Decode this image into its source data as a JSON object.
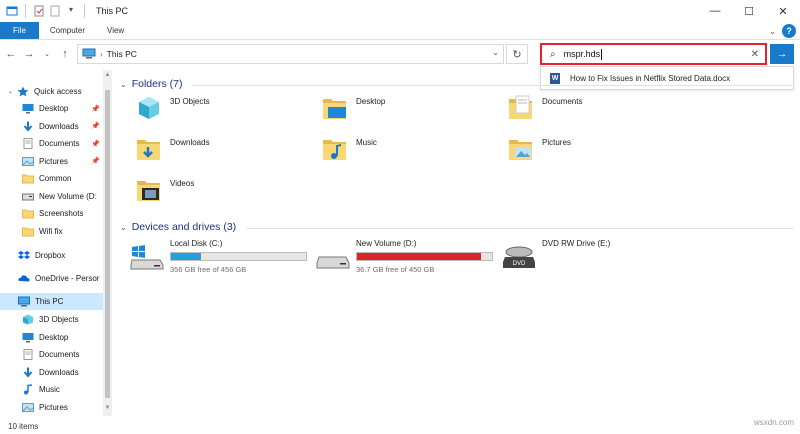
{
  "window": {
    "title": "This PC",
    "controls": [
      "minimize",
      "maximize",
      "close"
    ]
  },
  "ribbon": {
    "tabs": [
      "File",
      "Computer",
      "View"
    ]
  },
  "address": {
    "location": "This PC"
  },
  "search": {
    "value": "mspr.hds",
    "suggestion": "How to Fix Issues in Netflix Stored Data.docx"
  },
  "sidebar": {
    "quick_access": "Quick access",
    "quick_items": [
      {
        "label": "Desktop",
        "icon": "desktop-icon",
        "pinned": true
      },
      {
        "label": "Downloads",
        "icon": "downloads-icon",
        "pinned": true
      },
      {
        "label": "Documents",
        "icon": "documents-icon",
        "pinned": true
      },
      {
        "label": "Pictures",
        "icon": "pictures-icon",
        "pinned": true
      },
      {
        "label": "Common",
        "icon": "folder-icon",
        "pinned": false
      },
      {
        "label": "New Volume (D:",
        "icon": "drive-icon",
        "pinned": false
      },
      {
        "label": "Screenshots",
        "icon": "folder-icon",
        "pinned": false
      },
      {
        "label": "Wifi fix",
        "icon": "folder-icon",
        "pinned": false
      }
    ],
    "dropbox": "Dropbox",
    "onedrive": "OneDrive - Persor",
    "this_pc": "This PC",
    "pc_items": [
      {
        "label": "3D Objects",
        "icon": "3d-objects-icon"
      },
      {
        "label": "Desktop",
        "icon": "desktop-icon"
      },
      {
        "label": "Documents",
        "icon": "documents-icon"
      },
      {
        "label": "Downloads",
        "icon": "downloads-icon"
      },
      {
        "label": "Music",
        "icon": "music-icon"
      },
      {
        "label": "Pictures",
        "icon": "pictures-icon"
      }
    ]
  },
  "main": {
    "folders_header": "Folders (7)",
    "folders": [
      {
        "label": "3D Objects",
        "icon": "3d-objects-icon"
      },
      {
        "label": "Desktop",
        "icon": "desktop-icon"
      },
      {
        "label": "Documents",
        "icon": "documents-icon"
      },
      {
        "label": "Downloads",
        "icon": "downloads-icon"
      },
      {
        "label": "Music",
        "icon": "music-icon"
      },
      {
        "label": "Pictures",
        "icon": "pictures-icon"
      },
      {
        "label": "Videos",
        "icon": "videos-icon"
      }
    ],
    "drives_header": "Devices and drives (3)",
    "drives": [
      {
        "label": "Local Disk (C:)",
        "free": "356 GB free of 456 GB",
        "used_fraction": 0.22,
        "color": "#26a0da"
      },
      {
        "label": "New Volume (D:)",
        "free": "36.7 GB free of 450 GB",
        "used_fraction": 0.92,
        "color": "#da2626"
      },
      {
        "label": "DVD RW Drive (E:)",
        "free": "",
        "used_fraction": null,
        "color": null
      }
    ]
  },
  "status": {
    "items_count": "10 items"
  },
  "watermark": "wsxdn.com",
  "colors": {
    "accent": "#1979ca",
    "highlight_box": "#e0262c",
    "selected": "#cce8ff",
    "folder": "#f8d775"
  }
}
